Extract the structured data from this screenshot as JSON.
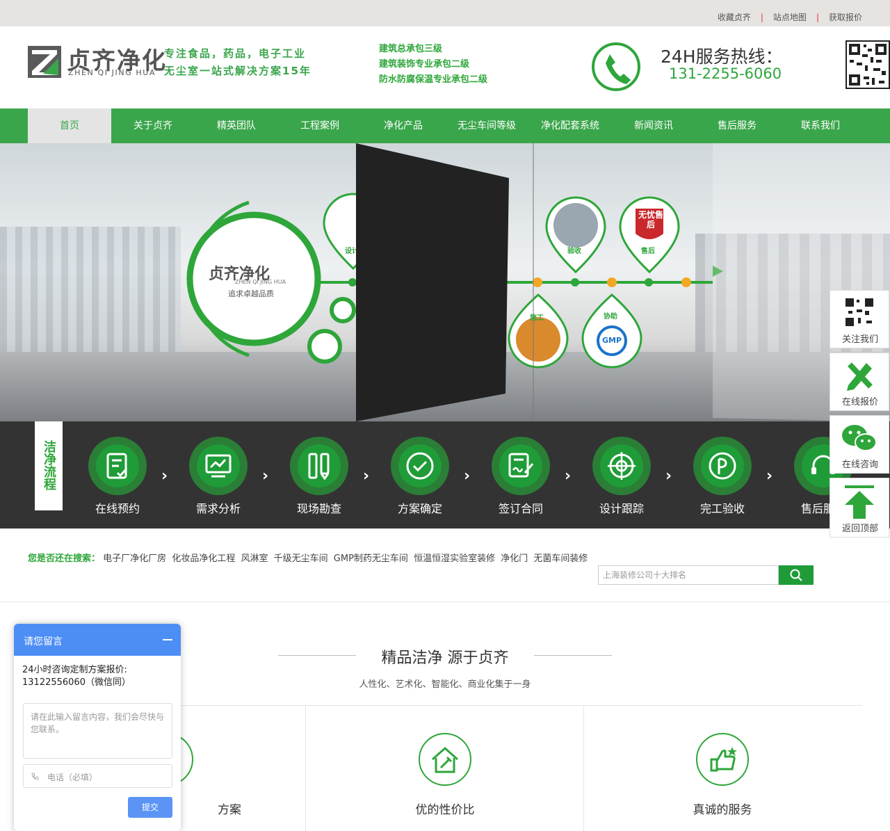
{
  "top_links": [
    "收藏贞齐",
    "站点地图",
    "获取报价"
  ],
  "brand": {
    "name": "贞齐净化",
    "pinyin": "ZHEN QI JING HUA",
    "slogan_line1": "专注食品，药品，电子工业",
    "slogan_line2": "无尘室一站式解决方案15年"
  },
  "qualifications": [
    "建筑总承包三级",
    "建筑装饰专业承包二级",
    "防水防腐保温专业承包二级"
  ],
  "hotline": {
    "title": "24H服务热线：",
    "number": "131-2255-6060"
  },
  "nav": [
    "首页",
    "关于贞齐",
    "精英团队",
    "工程案例",
    "净化产品",
    "无尘车间等级",
    "净化配套系统",
    "新闻资讯",
    "售后服务",
    "联系我们"
  ],
  "banner": {
    "logo_name": "贞齐净化",
    "logo_pinyin": "ZHEN QI JING HUA",
    "logo_slogan": "追求卓越品质",
    "pins": [
      "设计",
      "验收",
      "售后",
      "施工",
      "协助"
    ],
    "badge_text": "无忧售后",
    "gmp": "GMP"
  },
  "flow": {
    "tag": "洁净流程",
    "steps": [
      "在线预约",
      "需求分析",
      "现场勘查",
      "方案确定",
      "签订合同",
      "设计跟踪",
      "完工验收",
      "售后服务"
    ]
  },
  "search": {
    "label": "您是否还在搜索：",
    "keywords": [
      "电子厂净化厂房",
      "化妆品净化工程",
      "风淋室",
      "千级无尘车间",
      "GMP制药无尘车间",
      "恒温恒湿实验室装修",
      "净化门",
      "无菌车间装修"
    ],
    "placeholder": "上海装修公司十大排名"
  },
  "section": {
    "title": "精品洁净 源于贞齐",
    "subtitle": "人性化、艺术化、智能化、商业化集于一身",
    "features": [
      "方案",
      "优的性价比",
      "真诚的服务"
    ]
  },
  "side": [
    "关注我们",
    "在线报价",
    "在线咨询",
    "返回顶部"
  ],
  "chat": {
    "header": "请您留言",
    "message": "24小时咨询定制方案报价: 13122556060（微信同）",
    "textarea_placeholder": "请在此输入留言内容，我们会尽快与您联系。",
    "phone_placeholder": "电话（必填）",
    "submit": "提交"
  },
  "colors": {
    "green": "#3aa64b",
    "dark_green": "#1f9c38",
    "flow_bg": "#333333",
    "chat_blue": "#4d8ef5"
  }
}
